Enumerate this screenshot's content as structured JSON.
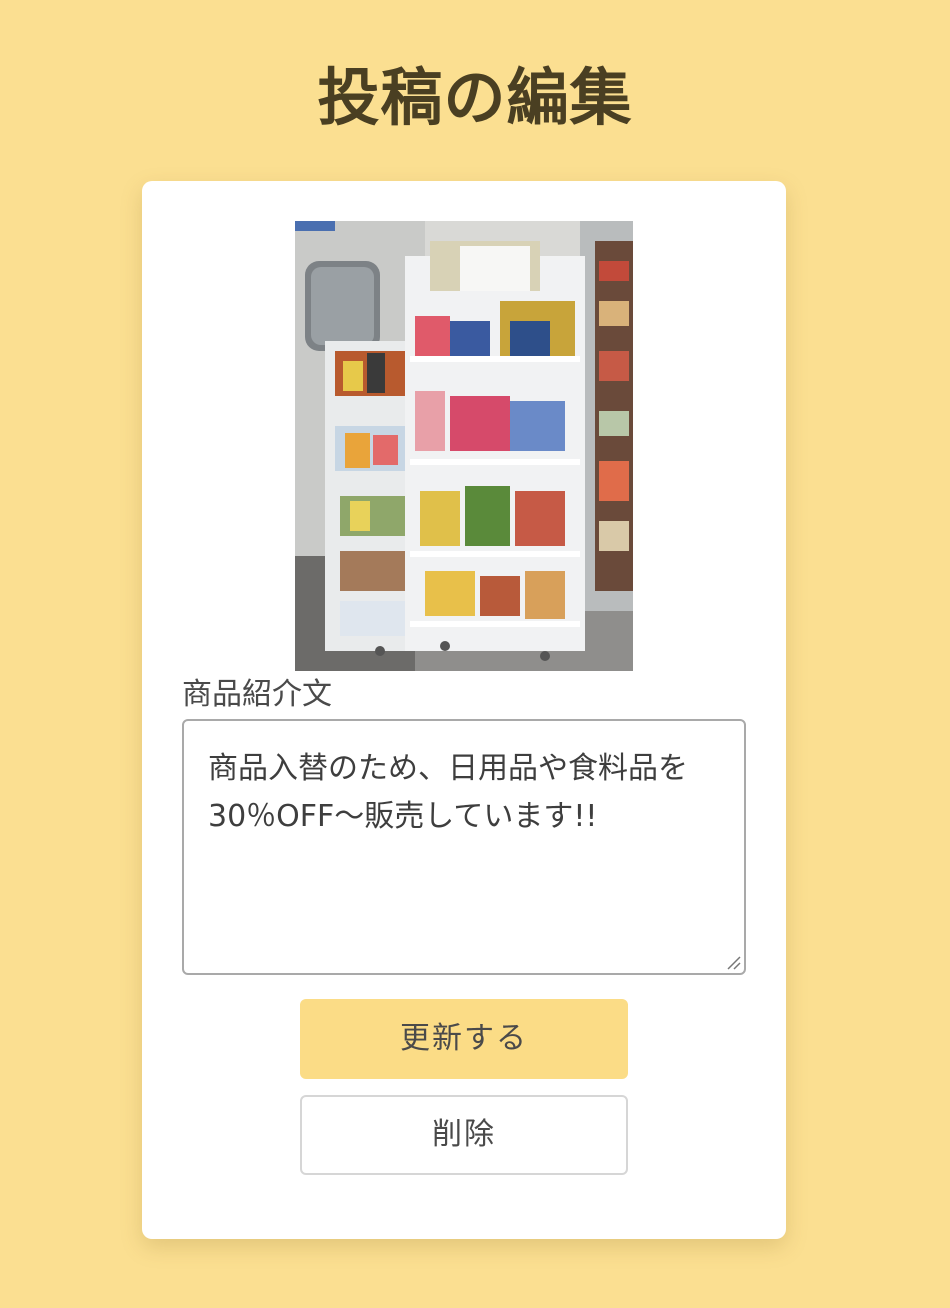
{
  "header": {
    "title": "投稿の編集"
  },
  "form": {
    "image": {
      "alt": "商品棚の写真"
    },
    "description": {
      "label": "商品紹介文",
      "value": "商品入替のため、日用品や食料品を30％OFF〜販売しています!!"
    },
    "update_button_label": "更新する",
    "delete_button_label": "削除"
  },
  "colors": {
    "page_background": "#fbdf91",
    "card_background": "#ffffff",
    "primary_button": "#fbdc86",
    "title_text": "#4a3f22"
  }
}
